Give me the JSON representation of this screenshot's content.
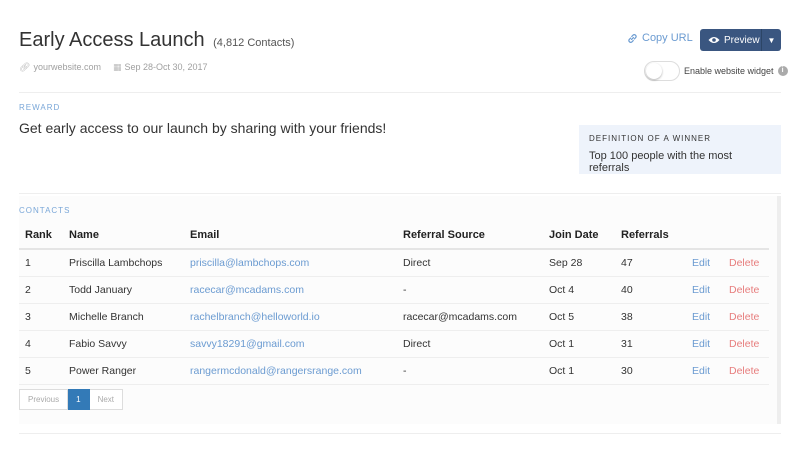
{
  "campaign": {
    "title": "Early Access Launch",
    "contacts_count": "(4,812 Contacts)",
    "website": "yourwebsite.com",
    "date_range": "Sep 28-Oct 30, 2017"
  },
  "actions": {
    "copy_url": "Copy URL",
    "preview": "Preview",
    "widget_label": "Enable website widget"
  },
  "reward": {
    "label": "REWARD",
    "text": "Get early access to our launch by sharing with your friends!"
  },
  "winner": {
    "label": "DEFINITION OF A WINNER",
    "text": "Top 100 people with the most referrals"
  },
  "contacts": {
    "label": "CONTACTS",
    "columns": [
      "Rank",
      "Name",
      "Email",
      "Referral Source",
      "Join Date",
      "Referrals"
    ],
    "edit_label": "Edit",
    "delete_label": "Delete",
    "rows": [
      {
        "rank": "1",
        "name": "Priscilla Lambchops",
        "email": "priscilla@lambchops.com",
        "source": "Direct",
        "date": "Sep 28",
        "referrals": "47"
      },
      {
        "rank": "2",
        "name": "Todd January",
        "email": "racecar@mcadams.com",
        "source": "-",
        "date": "Oct 4",
        "referrals": "40"
      },
      {
        "rank": "3",
        "name": "Michelle Branch",
        "email": "rachelbranch@helloworld.io",
        "source": "racecar@mcadams.com",
        "date": "Oct 5",
        "referrals": "38"
      },
      {
        "rank": "4",
        "name": "Fabio Savvy",
        "email": "savvy18291@gmail.com",
        "source": "Direct",
        "date": "Oct 1",
        "referrals": "31"
      },
      {
        "rank": "5",
        "name": "Power Ranger",
        "email": "rangermcdonald@rangersrange.com",
        "source": "-",
        "date": "Oct 1",
        "referrals": "30"
      }
    ]
  },
  "pagination": {
    "previous": "Previous",
    "current": "1",
    "next": "Next"
  },
  "colors": {
    "accent": "#6b9bd1",
    "primary_button": "#3a5680",
    "danger": "#e77d7d",
    "winner_bg": "#eef3fb"
  }
}
